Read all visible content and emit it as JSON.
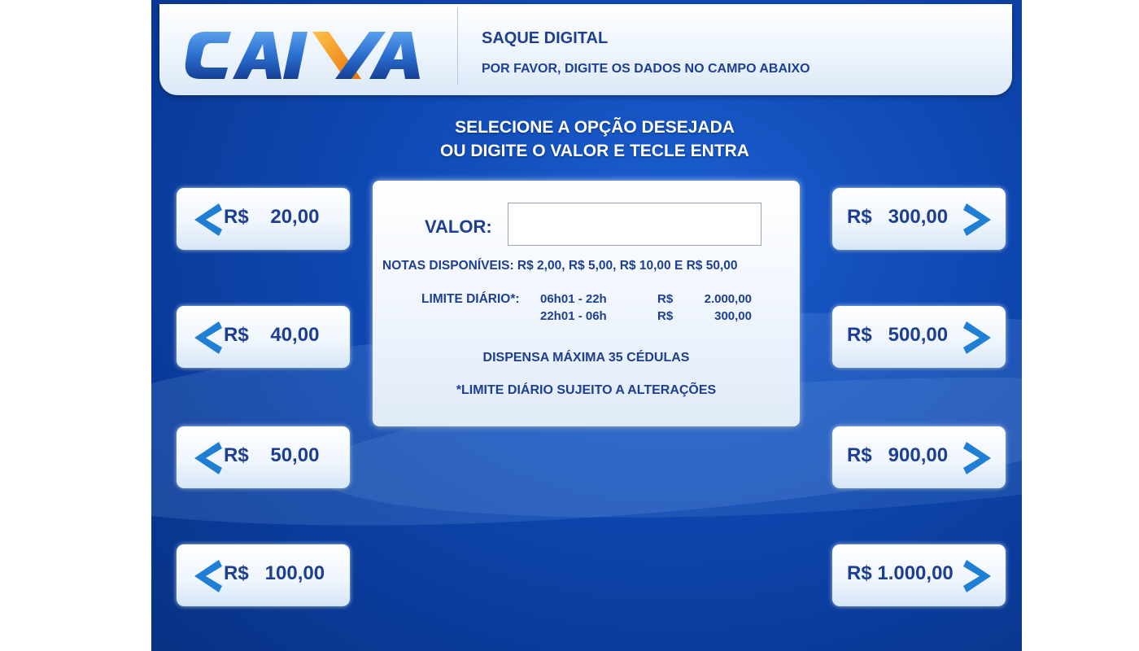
{
  "header": {
    "logo_text": "CAIXA",
    "title": "SAQUE DIGITAL",
    "subtitle": "POR FAVOR, DIGITE OS DADOS NO CAMPO ABAIXO"
  },
  "instruction": {
    "line1": "SELECIONE A OPÇÃO DESEJADA",
    "line2": "OU DIGITE O VALOR E TECLE ENTRA"
  },
  "left_options": [
    {
      "label": "R$    20,00"
    },
    {
      "label": "R$    40,00"
    },
    {
      "label": "R$    50,00"
    },
    {
      "label": "R$   100,00"
    }
  ],
  "right_options": [
    {
      "label": "R$   300,00"
    },
    {
      "label": "R$   500,00"
    },
    {
      "label": "R$   900,00"
    },
    {
      "label": "R$ 1.000,00"
    }
  ],
  "panel": {
    "valor_label": "VALOR:",
    "valor_value": "",
    "notas": "NOTAS DISPONÍVEIS: R$ 2,00, R$ 5,00, R$ 10,00 E R$ 50,00",
    "limite_label": "LIMITE DIÁRIO*:",
    "limites": [
      {
        "periodo": "06h01 - 22h",
        "moeda": "R$",
        "valor": "2.000,00"
      },
      {
        "periodo": "22h01 - 06h",
        "moeda": "R$",
        "valor": "300,00"
      }
    ],
    "dispensa": "DISPENSA MÁXIMA 35 CÉDULAS",
    "aviso": "*LIMITE DIÁRIO SUJEITO A ALTERAÇÕES"
  },
  "colors": {
    "background": "#0f49b4",
    "text": "#1d3f91",
    "chevron": "#1f7fd4",
    "logo_blue": "#2b6fcf",
    "logo_orange": "#f39019"
  }
}
